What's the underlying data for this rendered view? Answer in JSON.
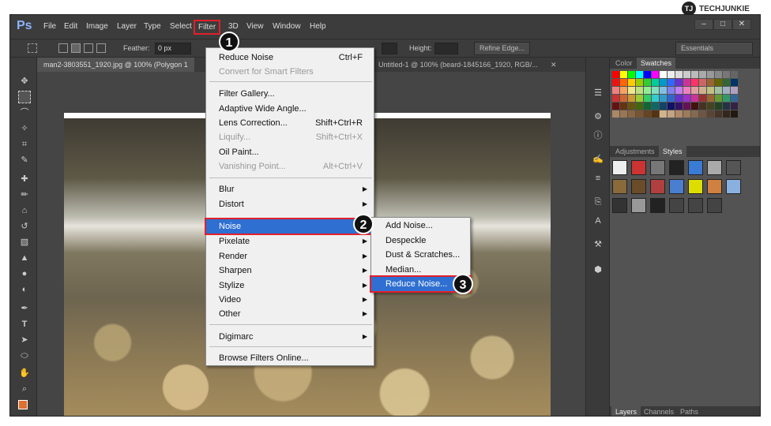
{
  "brand": {
    "badge": "TJ",
    "name": "TECHJUNKIE"
  },
  "menubar": {
    "logo": "Ps",
    "items": [
      "File",
      "Edit",
      "Image",
      "Layer",
      "Type",
      "Select",
      "Filter",
      "3D",
      "View",
      "Window",
      "Help"
    ],
    "window_buttons": [
      "–",
      "□",
      "✕"
    ]
  },
  "options": {
    "feather_label": "Feather:",
    "feather_value": "0 px",
    "height_label": "Height:",
    "refine_edge": "Refine Edge...",
    "workspace": "Essentials"
  },
  "tabs": [
    {
      "label": "man2-3803551_1920.jpg @ 100% (Polygon 1"
    },
    {
      "label": "Untitled-1 @ 100% (beard-1845166_1920, RGB/..."
    }
  ],
  "tab_close": "✕",
  "filter_menu": {
    "items": [
      {
        "label": "Reduce Noise",
        "shortcut": "Ctrl+F",
        "disabled": false
      },
      {
        "label": "Convert for Smart Filters",
        "shortcut": "",
        "disabled": true
      },
      {
        "label": "Filter Gallery...",
        "shortcut": "",
        "disabled": false
      },
      {
        "label": "Adaptive Wide Angle...",
        "shortcut": "",
        "disabled": false
      },
      {
        "label": "Lens Correction...",
        "shortcut": "Shift+Ctrl+R",
        "disabled": false
      },
      {
        "label": "Liquify...",
        "shortcut": "Shift+Ctrl+X",
        "disabled": true
      },
      {
        "label": "Oil Paint...",
        "shortcut": "",
        "disabled": false
      },
      {
        "label": "Vanishing Point...",
        "shortcut": "Alt+Ctrl+V",
        "disabled": true
      },
      {
        "label": "Blur"
      },
      {
        "label": "Distort"
      },
      {
        "label": "Noise"
      },
      {
        "label": "Pixelate"
      },
      {
        "label": "Render"
      },
      {
        "label": "Sharpen"
      },
      {
        "label": "Stylize"
      },
      {
        "label": "Video"
      },
      {
        "label": "Other"
      },
      {
        "label": "Digimarc"
      },
      {
        "label": "Browse Filters Online..."
      }
    ]
  },
  "noise_menu": {
    "items": [
      "Add Noise...",
      "Despeckle",
      "Dust & Scratches...",
      "Median...",
      "Reduce Noise..."
    ]
  },
  "steps": [
    "1",
    "2",
    "3"
  ],
  "panels": {
    "top_tabs": [
      "Color",
      "Swatches"
    ],
    "mid_tabs": [
      "Adjustments",
      "Styles"
    ],
    "bottom_tabs": [
      "Layers",
      "Channels",
      "Paths"
    ]
  },
  "colors": {
    "accent_highlight": "#2f6fd1",
    "callout_red": "#e0202a"
  }
}
